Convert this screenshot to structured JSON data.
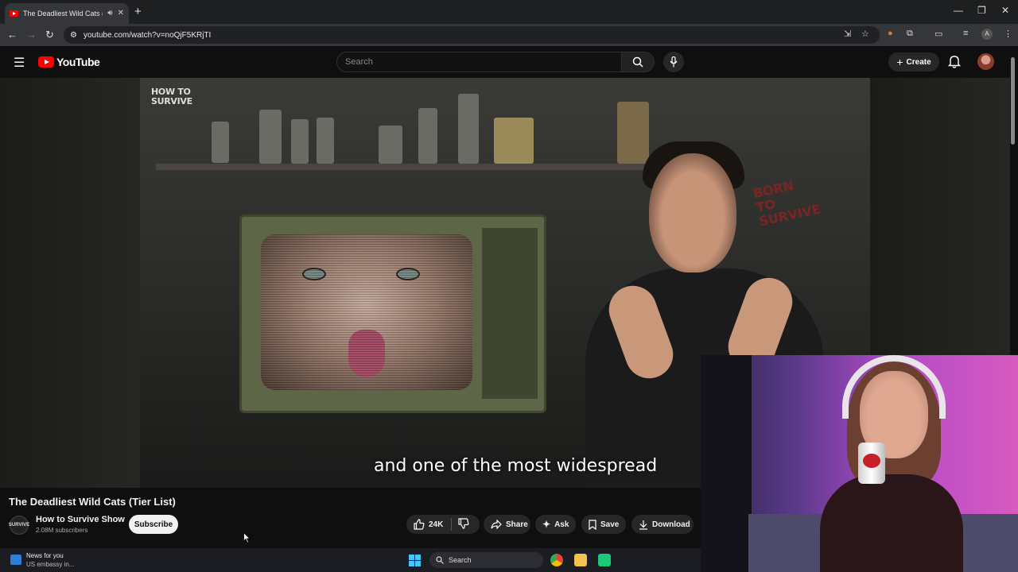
{
  "browser": {
    "tab_title": "The Deadliest Wild Cats (Tier",
    "url": "youtube.com/watch?v=noQjF5KRjTI"
  },
  "youtube": {
    "logo_text": "YouTube",
    "search_placeholder": "Search",
    "create_label": "Create"
  },
  "video": {
    "brand_watermark": "HOW TO\nSURVIVE",
    "graffiti_text": "BORN TO SURVIVE",
    "caption": "and one of the most widespread",
    "title": "The Deadliest Wild Cats (Tier List)"
  },
  "channel": {
    "avatar_text": "SURVIVE",
    "name": "How to Survive Show",
    "subscribers": "2.08M subscribers",
    "subscribe_label": "Subscribe"
  },
  "actions": {
    "likes": "24K",
    "share": "Share",
    "ask": "Ask",
    "save": "Save",
    "download": "Download"
  },
  "taskbar": {
    "news_title": "News for you",
    "news_sub": "US embassy in...",
    "search_label": "Search"
  },
  "icons": [
    "youtube-favicon",
    "speaker-icon",
    "close-icon",
    "plus-icon",
    "minimize-icon",
    "maximize-icon",
    "back-icon",
    "forward-icon",
    "reload-icon",
    "site-info-icon",
    "install-icon",
    "bookmark-star-icon",
    "extension-icon",
    "puzzle-icon",
    "sidebar-icon",
    "media-icon",
    "kebab-menu-icon",
    "hamburger-icon",
    "search-icon",
    "mic-icon",
    "bell-icon",
    "thumbs-up-icon",
    "thumbs-down-icon",
    "share-icon",
    "sparkle-icon",
    "bookmark-icon",
    "download-icon",
    "windows-start-icon",
    "chrome-icon",
    "file-explorer-icon"
  ],
  "colors": {
    "youtube_red": "#ff0000",
    "background": "#0f0f0f",
    "pill_bg": "#272727"
  }
}
